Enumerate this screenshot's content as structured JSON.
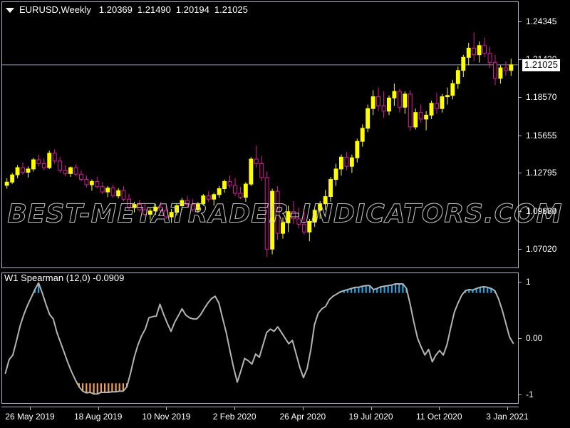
{
  "window": {
    "background_color": "#000000",
    "foreground_color": "#ffffff",
    "border_color": "#b4b4c8"
  },
  "header": {
    "collapse_icon": "triangle-down-icon",
    "symbol_timeframe": "EURUSD,Weekly",
    "ohlc": [
      "1.20369",
      "1.21490",
      "1.20194",
      "1.21025"
    ]
  },
  "watermark": {
    "text": "BEST-METATRADER-INDICATORS.COM"
  },
  "price_axis": {
    "labels": [
      "1.24345",
      "1.21430",
      "1.18570",
      "1.15655",
      "1.12795",
      "1.09880",
      "1.07020"
    ],
    "current_price": "1.21025",
    "current_price_bg": "#ffffff",
    "current_price_fg": "#000000",
    "price_line_color": "#8c96b4"
  },
  "indicator": {
    "header": "W1 Spearman (12,0) -0.0909",
    "name": "W1 Spearman",
    "params": "(12,0)",
    "value": "-0.0909",
    "axis_labels": [
      "1",
      "0.00",
      "-1"
    ],
    "line_color": "#b4b4b4",
    "overbought_bar_color": "#1ea6e6",
    "oversold_bar_color": "#f0a055"
  },
  "time_axis": {
    "labels": [
      "26 May 2019",
      "18 Aug 2019",
      "10 Nov 2019",
      "2 Feb 2020",
      "26 Apr 2020",
      "19 Jul 2020",
      "11 Oct 2020",
      "3 Jan 2021"
    ]
  },
  "chart_data": {
    "type": "line",
    "title": "EURUSD,Weekly",
    "xlabel": "",
    "ylabel": "",
    "grid": false,
    "legend": "top-left",
    "panes": [
      {
        "name": "price",
        "type": "candlestick",
        "bull_color": "#ffff00",
        "bear_color": "#e0189c",
        "ylim": [
          1.056,
          1.258
        ],
        "yticks": [
          1.24345,
          1.2143,
          1.1857,
          1.15655,
          1.12795,
          1.0988,
          1.0702
        ],
        "current_price": 1.21025,
        "ohlc": [
          [
            1.1185,
            1.124,
            1.116,
            1.121
          ],
          [
            1.121,
            1.128,
            1.1195,
            1.1265
          ],
          [
            1.1265,
            1.134,
            1.124,
            1.132
          ],
          [
            1.132,
            1.136,
            1.1265,
            1.1285
          ],
          [
            1.1285,
            1.133,
            1.1245,
            1.131
          ],
          [
            1.131,
            1.1395,
            1.129,
            1.138
          ],
          [
            1.138,
            1.142,
            1.133,
            1.135
          ],
          [
            1.135,
            1.139,
            1.13,
            1.132
          ],
          [
            1.132,
            1.145,
            1.131,
            1.143
          ],
          [
            1.143,
            1.146,
            1.135,
            1.137
          ],
          [
            1.137,
            1.14,
            1.128,
            1.13
          ],
          [
            1.13,
            1.134,
            1.1255,
            1.1275
          ],
          [
            1.1275,
            1.133,
            1.125,
            1.132
          ],
          [
            1.132,
            1.1345,
            1.1255,
            1.127
          ],
          [
            1.127,
            1.13,
            1.1215,
            1.123
          ],
          [
            1.123,
            1.126,
            1.117,
            1.119
          ],
          [
            1.119,
            1.123,
            1.1145,
            1.1215
          ],
          [
            1.1215,
            1.125,
            1.116,
            1.1175
          ],
          [
            1.1175,
            1.121,
            1.112,
            1.1135
          ],
          [
            1.1135,
            1.118,
            1.1095,
            1.1165
          ],
          [
            1.1165,
            1.119,
            1.109,
            1.1105
          ],
          [
            1.1105,
            1.1165,
            1.1085,
            1.1145
          ],
          [
            1.1145,
            1.118,
            1.1065,
            1.108
          ],
          [
            1.108,
            1.112,
            1.1,
            1.1015
          ],
          [
            1.1015,
            1.106,
            1.098,
            1.104
          ],
          [
            1.104,
            1.1075,
            1.0985,
            1.1
          ],
          [
            1.1,
            1.1045,
            1.095,
            1.0965
          ],
          [
            1.0965,
            1.101,
            1.0925,
            1.099
          ],
          [
            1.099,
            1.1045,
            1.096,
            1.102
          ],
          [
            1.102,
            1.106,
            1.0975,
            1.0995
          ],
          [
            1.0995,
            1.103,
            1.093,
            1.0945
          ],
          [
            1.0945,
            1.1005,
            1.09,
            1.098
          ],
          [
            1.098,
            1.105,
            1.0955,
            1.103
          ],
          [
            1.103,
            1.109,
            1.1,
            1.107
          ],
          [
            1.107,
            1.1105,
            1.102,
            1.104
          ],
          [
            1.104,
            1.108,
            1.0985,
            1.1
          ],
          [
            1.1,
            1.106,
            1.0975,
            1.1045
          ],
          [
            1.1045,
            1.112,
            1.103,
            1.1105
          ],
          [
            1.1105,
            1.114,
            1.106,
            1.108
          ],
          [
            1.108,
            1.113,
            1.103,
            1.1115
          ],
          [
            1.1115,
            1.118,
            1.109,
            1.116
          ],
          [
            1.116,
            1.123,
            1.113,
            1.1215
          ],
          [
            1.1215,
            1.126,
            1.1165,
            1.1185
          ],
          [
            1.1185,
            1.124,
            1.1105,
            1.1125
          ],
          [
            1.1125,
            1.1175,
            1.108,
            1.1095
          ],
          [
            1.1095,
            1.121,
            1.106,
            1.1195
          ],
          [
            1.1195,
            1.14,
            1.118,
            1.1385
          ],
          [
            1.1385,
            1.149,
            1.132,
            1.135
          ],
          [
            1.135,
            1.141,
            1.122,
            1.1245
          ],
          [
            1.1245,
            1.129,
            1.064,
            1.07
          ],
          [
            1.07,
            1.116,
            1.066,
            1.114
          ],
          [
            1.114,
            1.118,
            1.077,
            1.082
          ],
          [
            1.082,
            1.094,
            1.078,
            1.09
          ],
          [
            1.09,
            1.103,
            1.083,
            1.0985
          ],
          [
            1.0985,
            1.1065,
            1.089,
            1.093
          ],
          [
            1.093,
            1.1015,
            1.086,
            1.089
          ],
          [
            1.089,
            1.099,
            1.081,
            1.083
          ],
          [
            1.083,
            1.093,
            1.076,
            1.091
          ],
          [
            1.091,
            1.101,
            1.087,
            1.0995
          ],
          [
            1.0995,
            1.1065,
            1.093,
            1.1045
          ],
          [
            1.1045,
            1.115,
            1.1,
            1.11
          ],
          [
            1.11,
            1.125,
            1.106,
            1.123
          ],
          [
            1.123,
            1.135,
            1.118,
            1.131
          ],
          [
            1.131,
            1.142,
            1.126,
            1.14
          ],
          [
            1.14,
            1.144,
            1.13,
            1.133
          ],
          [
            1.133,
            1.142,
            1.128,
            1.1395
          ],
          [
            1.1395,
            1.154,
            1.136,
            1.152
          ],
          [
            1.152,
            1.165,
            1.148,
            1.162
          ],
          [
            1.162,
            1.18,
            1.159,
            1.177
          ],
          [
            1.177,
            1.191,
            1.172,
            1.186
          ],
          [
            1.186,
            1.193,
            1.175,
            1.179
          ],
          [
            1.179,
            1.19,
            1.17,
            1.175
          ],
          [
            1.175,
            1.187,
            1.172,
            1.185
          ],
          [
            1.185,
            1.196,
            1.179,
            1.19
          ],
          [
            1.19,
            1.192,
            1.174,
            1.178
          ],
          [
            1.178,
            1.19,
            1.173,
            1.188
          ],
          [
            1.188,
            1.191,
            1.16,
            1.163
          ],
          [
            1.163,
            1.177,
            1.161,
            1.174
          ],
          [
            1.174,
            1.18,
            1.166,
            1.169
          ],
          [
            1.169,
            1.175,
            1.1605,
            1.172
          ],
          [
            1.172,
            1.183,
            1.169,
            1.181
          ],
          [
            1.181,
            1.189,
            1.173,
            1.177
          ],
          [
            1.177,
            1.188,
            1.174,
            1.186
          ],
          [
            1.186,
            1.193,
            1.18,
            1.187
          ],
          [
            1.187,
            1.199,
            1.184,
            1.196
          ],
          [
            1.196,
            1.209,
            1.192,
            1.206
          ],
          [
            1.206,
            1.218,
            1.201,
            1.216
          ],
          [
            1.216,
            1.227,
            1.21,
            1.223
          ],
          [
            1.223,
            1.235,
            1.213,
            1.218
          ],
          [
            1.218,
            1.228,
            1.212,
            1.225
          ],
          [
            1.225,
            1.231,
            1.216,
            1.219
          ],
          [
            1.219,
            1.224,
            1.208,
            1.212
          ],
          [
            1.212,
            1.218,
            1.195,
            1.2
          ],
          [
            1.2,
            1.21,
            1.196,
            1.208
          ],
          [
            1.208,
            1.213,
            1.202,
            1.206
          ],
          [
            1.206,
            1.2149,
            1.2019,
            1.21025
          ]
        ]
      },
      {
        "name": "spearman",
        "type": "line",
        "series_name": "W1 Spearman (12,0)",
        "last_value": -0.0909,
        "ylim": [
          -1.15,
          1.15
        ],
        "yticks": [
          1,
          0,
          -1
        ],
        "overbought_level": 0.8,
        "oversold_level": -0.8,
        "values": [
          -0.62,
          -0.38,
          -0.3,
          -0.05,
          0.22,
          0.42,
          0.58,
          0.72,
          0.86,
          0.98,
          0.8,
          0.6,
          0.42,
          0.34,
          0.1,
          -0.08,
          -0.26,
          -0.44,
          -0.6,
          -0.74,
          -0.86,
          -0.94,
          -0.97,
          -0.96,
          -0.99,
          -0.99,
          -0.96,
          -0.96,
          -0.96,
          -0.95,
          -0.95,
          -0.94,
          -0.94,
          -0.86,
          -0.62,
          -0.34,
          -0.12,
          0.04,
          0.16,
          0.36,
          0.38,
          0.39,
          0.6,
          0.42,
          0.26,
          0.12,
          0.28,
          0.4,
          0.52,
          0.41,
          0.36,
          0.34,
          0.34,
          0.41,
          0.52,
          0.62,
          0.7,
          0.74,
          0.62,
          0.36,
          0.1,
          -0.22,
          -0.52,
          -0.78,
          -0.58,
          -0.36,
          -0.4,
          -0.46,
          -0.28,
          -0.34,
          -0.12,
          0.1,
          0.16,
          0.12,
          0.2,
          0.1,
          0.0,
          -0.1,
          -0.04,
          -0.28,
          -0.52,
          -0.7,
          -0.54,
          -0.2,
          0.24,
          0.44,
          0.52,
          0.56,
          0.68,
          0.74,
          0.78,
          0.82,
          0.84,
          0.86,
          0.88,
          0.9,
          0.9,
          0.92,
          0.93,
          0.93,
          0.86,
          0.88,
          0.91,
          0.92,
          0.93,
          0.94,
          0.96,
          0.96,
          0.96,
          0.88,
          0.6,
          0.28,
          0.0,
          -0.16,
          -0.3,
          -0.2,
          -0.42,
          -0.3,
          -0.22,
          -0.3,
          -0.12,
          0.18,
          0.46,
          0.62,
          0.76,
          0.84,
          0.86,
          0.85,
          0.88,
          0.9,
          0.91,
          0.9,
          0.88,
          0.84,
          0.7,
          0.5,
          0.26,
          0.02,
          -0.0909
        ]
      }
    ]
  }
}
